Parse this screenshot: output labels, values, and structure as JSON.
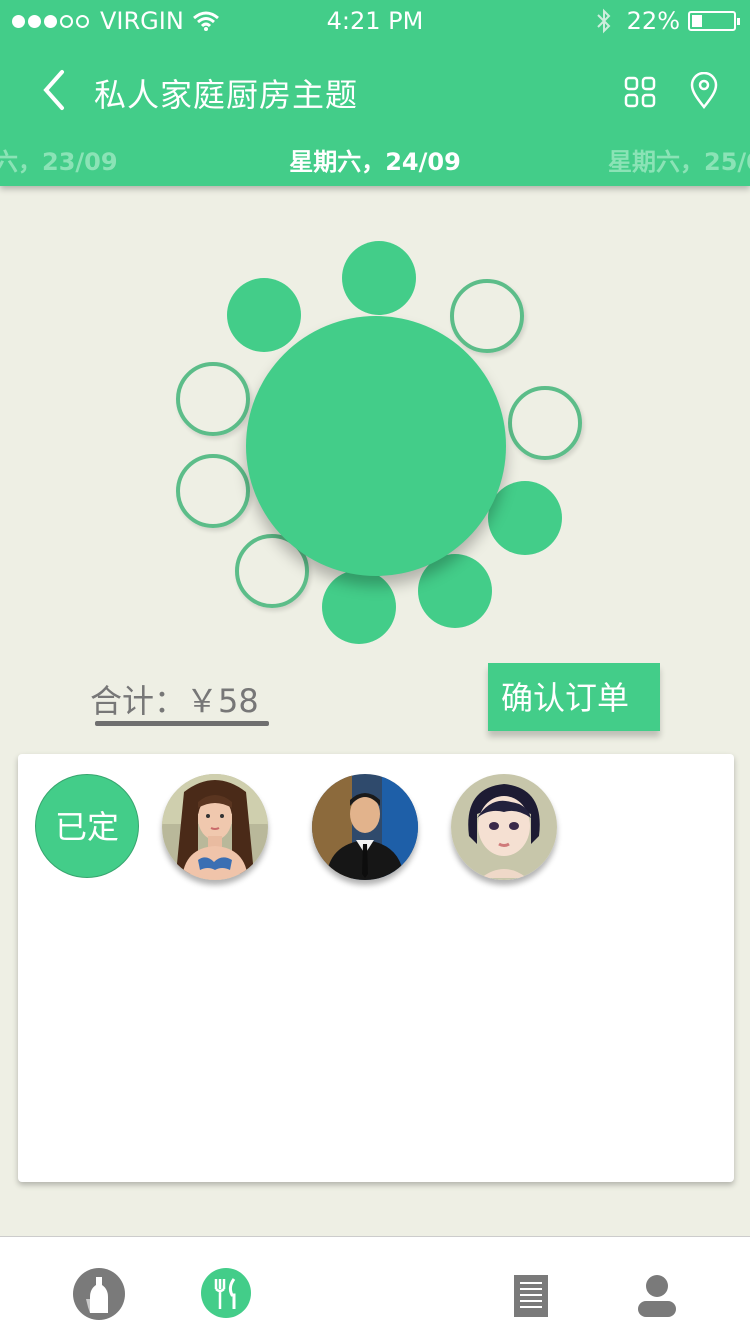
{
  "status_bar": {
    "carrier": "VIRGIN",
    "time": "4:21 PM",
    "battery": "22%",
    "signal_bars_filled": 3,
    "signal_bars_total": 5,
    "battery_level": 0.22
  },
  "nav": {
    "title": "私人家庭厨房主题",
    "back_icon": "chevron-left-icon",
    "grid_icon": "grid-icon",
    "location_icon": "location-pin-icon"
  },
  "dates": {
    "prev": "六，23/09",
    "current": "星期六，24/09",
    "next": "星期六，25/0"
  },
  "seats": {
    "taken_count": 5,
    "free_count": 5,
    "taken_color": "#43cd89"
  },
  "order": {
    "total": "合计：￥58",
    "confirm_label": "确认订单"
  },
  "diners": {
    "booked_label": "已定",
    "avatars": [
      "avatar-woman-bikini",
      "avatar-man-suit",
      "avatar-woman-short-hair"
    ]
  },
  "tabbar": {
    "items": [
      "drinks-icon",
      "dining-icon",
      "menu-list-icon",
      "profile-icon"
    ],
    "active": "dining-icon"
  },
  "colors": {
    "accent": "#43cd89",
    "background": "#eeefe4"
  }
}
